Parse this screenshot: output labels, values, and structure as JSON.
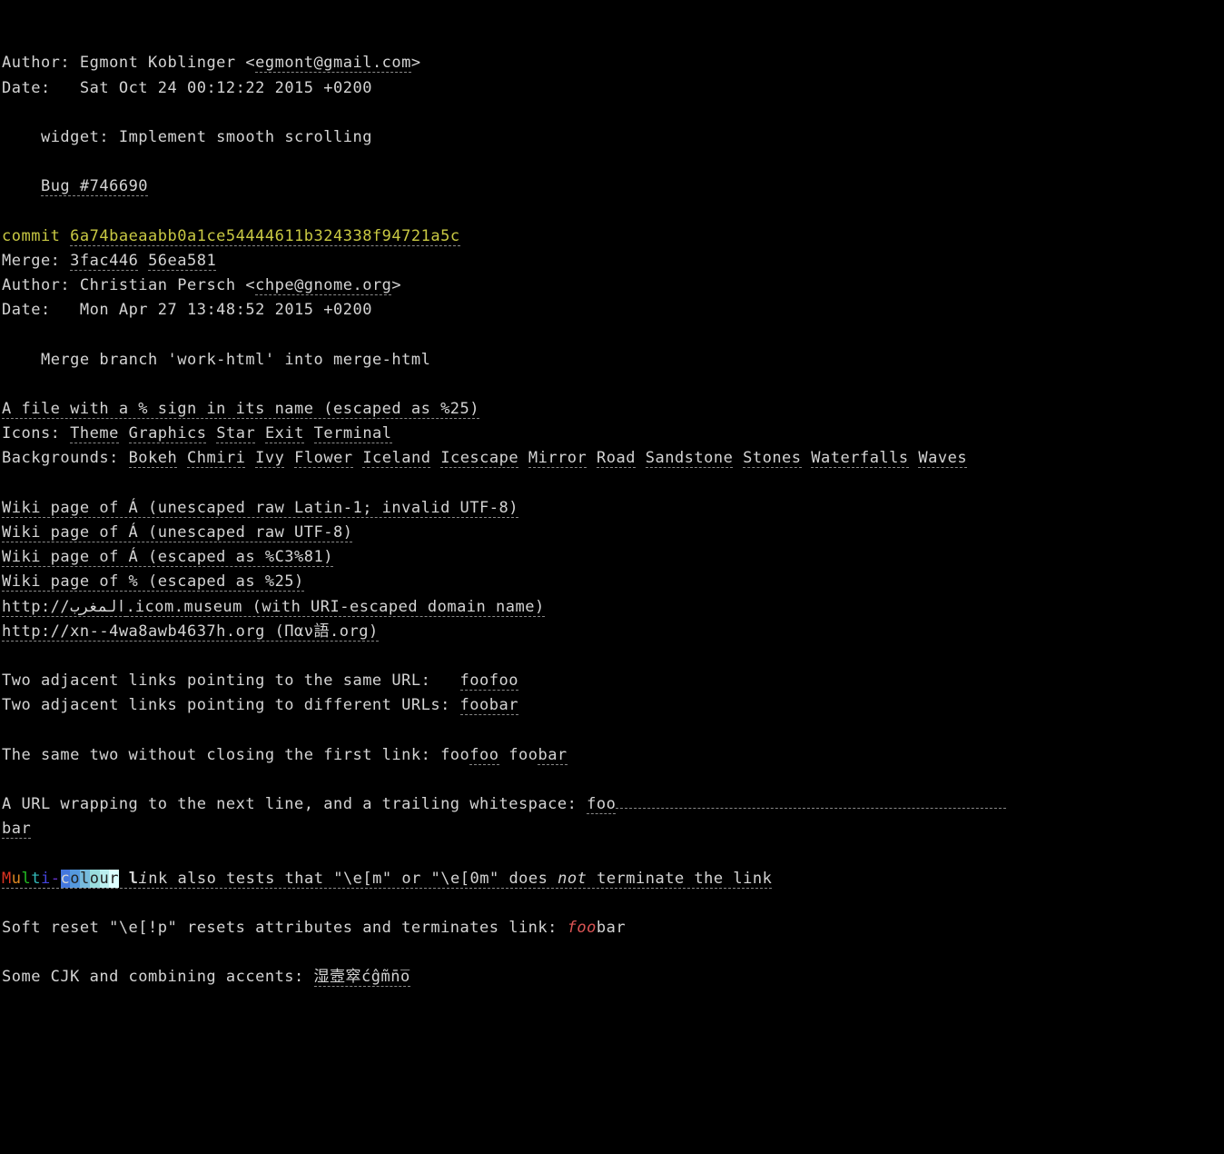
{
  "commit1": {
    "author_label": "Author:",
    "author_name": " Egmont Koblinger <",
    "author_email": "egmont@gmail.com",
    "author_close": ">",
    "date_label": "Date:  ",
    "date_value": " Sat Oct 24 00:12:22 2015 +0200",
    "message_line1": "    widget: Implement smooth scrolling",
    "bug_prefix": "    ",
    "bug_link": "Bug #746690"
  },
  "commit2": {
    "commit_label": "commit ",
    "commit_hash": "6a74baeaabb0a1ce54444611b324338f94721a5c",
    "merge_label": "Merge: ",
    "merge_hash1": "3fac446",
    "merge_space": " ",
    "merge_hash2": "56ea581",
    "author_label": "Author:",
    "author_name": " Christian Persch <",
    "author_email": "chpe@gnome.org",
    "author_close": ">",
    "date_label": "Date:  ",
    "date_value": " Mon Apr 27 13:48:52 2015 +0200",
    "message": "    Merge branch 'work-html' into merge-html"
  },
  "file_link": "A file with a % sign in its name (escaped as %25)",
  "icons": {
    "label": "Icons: ",
    "theme": "Theme",
    "graphics": "Graphics",
    "star": "Star",
    "exit": "Exit",
    "terminal": "Terminal"
  },
  "backgrounds": {
    "label": "Backgrounds: ",
    "items": [
      "Bokeh",
      "Chmiri",
      "Ivy",
      "Flower",
      "Iceland",
      "Icescape",
      "Mirror",
      "Road",
      "Sandstone",
      "Stones",
      "Waterfalls",
      "Waves"
    ]
  },
  "wiki": {
    "line1": "Wiki page of Á (unescaped raw Latin-1; invalid UTF-8)",
    "line2": "Wiki page of Á (unescaped raw UTF-8)",
    "line3": "Wiki page of Á (escaped as %C3%81)",
    "line4": "Wiki page of % (escaped as %25)",
    "line5a": "http://المغرب",
    "line5b": ".icom.museum (with URI-escaped domain name)",
    "line6": "http://xn--4wa8awb4637h.org (Παν語.org)"
  },
  "adjacent": {
    "same_label": "Two adjacent links pointing to the same URL:   ",
    "same_link": "foofoo",
    "diff_label": "Two adjacent links pointing to different URLs: ",
    "diff_link": "foobar",
    "no_close_label": "The same two without closing the first link: foo",
    "no_close_foo": "foo",
    "no_close_space": " foo",
    "no_close_bar": "bar",
    "wrap_label": "A URL wrapping to the next line, and a trailing whitespace: ",
    "wrap_foo": "foo",
    "wrap_bar": "bar"
  },
  "multi": {
    "M": "M",
    "u": "u",
    "l": "l",
    "t": "t",
    "i": "i",
    "dash": "-",
    "c": "c",
    "o": "o",
    "l2": "l",
    "o2": "o",
    "u2": "u",
    "r": "r",
    "space": " ",
    "l3": "l",
    "i2": "i",
    "rest1": "nk also tests that \"\\e[m\" or \"\\e[0m\" does ",
    "not": "not",
    "rest2": " terminate the link"
  },
  "reset": {
    "prefix": "Soft reset \"\\e[!p\" resets attributes and terminates link: ",
    "foo": "foo",
    "bar": "bar"
  },
  "cjk": {
    "prefix": "Some CJK and combining accents: ",
    "text": "湿壼窣ćĝm̃n̄o̅"
  }
}
